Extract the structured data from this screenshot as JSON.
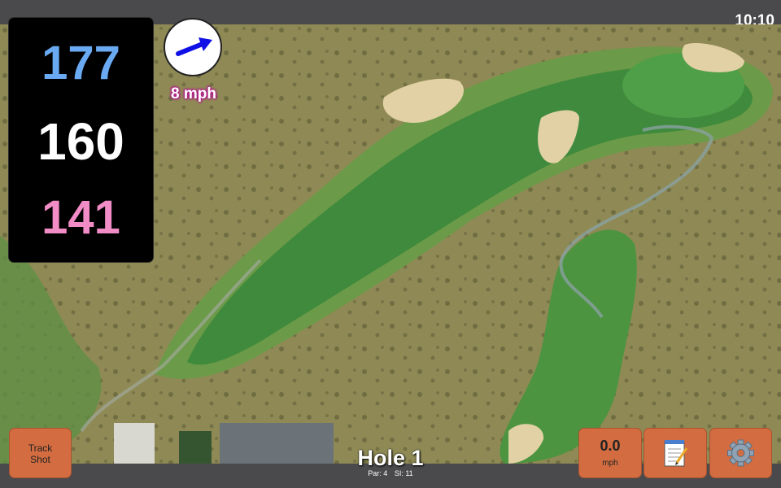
{
  "status_bar": {
    "time": "10:10"
  },
  "distances": {
    "back": "177",
    "middle": "160",
    "front": "141"
  },
  "wind": {
    "speed": "8 mph",
    "arrow_icon": "wind-direction-arrow-icon",
    "arrow_color": "#1010e6"
  },
  "hole": {
    "title": "Hole 1",
    "par": "Par: 4",
    "stroke_index": "SI: 11"
  },
  "buttons": {
    "track_shot_line1": "Track",
    "track_shot_line2": "Shot",
    "speed_value": "0.0",
    "speed_unit": "mph",
    "notes_icon": "notepad-icon",
    "settings_icon": "gear-icon"
  },
  "colors": {
    "back_distance": "#6aaaf3",
    "middle_distance": "#ffffff",
    "front_distance": "#f28cc6",
    "button": "#d36d41",
    "fairway": "#3f8a3c",
    "rough": "#8f8a55"
  }
}
